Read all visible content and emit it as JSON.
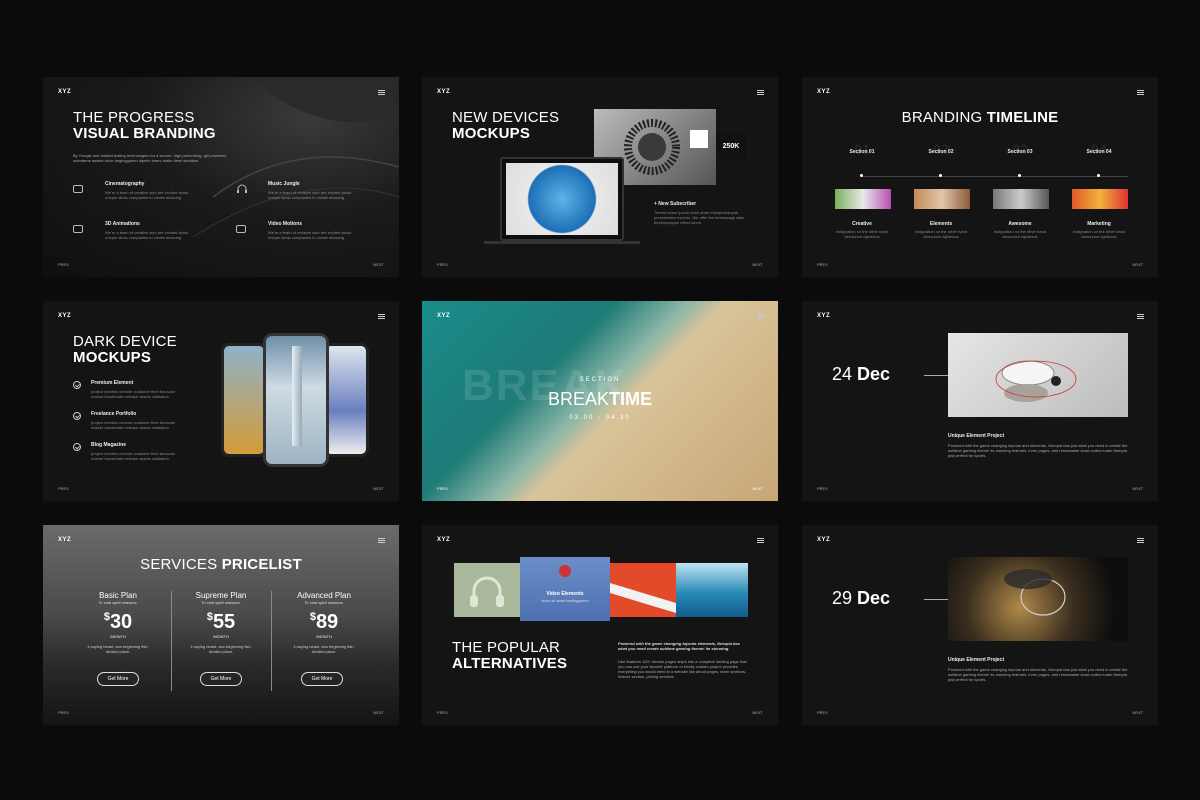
{
  "brand": "XYZ",
  "nav": {
    "prev": "PREV",
    "next": "NEXT"
  },
  "slide1": {
    "title_light": "THE PROGRESS",
    "title_bold": "VISUAL BRANDING",
    "intro": "By Google and related testing technologies for a secure, high performing, get powered orientame assets dolor beginggueen dipeim lorem make itemi semikim",
    "features": [
      {
        "title": "Cinematography",
        "desc": "We're a team of creative who are excited about unique ideas companies to create amazing",
        "icon": "layers-icon"
      },
      {
        "title": "Music Jungle",
        "desc": "We're a team of creative who are excited about unique ideas companies to create amazing",
        "icon": "headphones-icon"
      },
      {
        "title": "3D Animations",
        "desc": "We're a team of creative who are excited about unique ideas companies to create amazing",
        "icon": "cube-icon"
      },
      {
        "title": "Video Motions",
        "desc": "We're a team of creative who are excited about unique ideas companies to create amazing",
        "icon": "video-icon"
      }
    ]
  },
  "slide2": {
    "title_light": "NEW DEVICES",
    "title_bold": "MOCKUPS",
    "stat": "250K",
    "sub_title": "+ New Subscriber",
    "sub_desc": "Tereed lorem ipsum dolor amet memperbanyak presentation experts. We offer the formwpage silan bepersoyayan effect lorem."
  },
  "slide3": {
    "title_light": "BRANDING",
    "title_bold": "TIMELINE",
    "sections": [
      {
        "label": "Section 01",
        "num": "01",
        "name": "Creative",
        "desc": "Indignation on the other hand denounce righteous"
      },
      {
        "label": "Section 02",
        "num": "02",
        "name": "Elements",
        "desc": "Indignation on the other hand denounce righteous"
      },
      {
        "label": "Section 03",
        "num": "03",
        "name": "Awesome",
        "desc": "Indignation on the other hand denounce righteous"
      },
      {
        "label": "Section 04",
        "num": "04",
        "name": "Marketing",
        "desc": "Indignation on the other hand denounce righteous"
      }
    ]
  },
  "slide4": {
    "title_light": "DARK DEVICE",
    "title_bold": "MOCKUPS",
    "items": [
      {
        "title": "Premium Element",
        "desc": "project mentics venture customer then because market handshake release assets validation"
      },
      {
        "title": "Freelance Portfolio",
        "desc": "project mentics venture customer then because market handshake release assets validation"
      },
      {
        "title": "Blog Magazine",
        "desc": "project mentics venture customer then because market handshake release assets validation"
      }
    ]
  },
  "slide5": {
    "section": "SECTION",
    "bg_word": "BREAK",
    "title_light": "BREAK",
    "title_bold": "TIME",
    "time": "03.00 - 04.30"
  },
  "slide6": {
    "date_num": "24",
    "date_mon": "Dec",
    "heading": "Unique Element Project",
    "desc": "Powered with the game changing layouts and elements, Netopia has just what you need to create the sublime gaming theme! its stunning features, inner pages, and remarkable short codes make Netopia just perfect for sports."
  },
  "slide7": {
    "title_light": "SERVICES",
    "title_bold": "PRICELIST",
    "plans": [
      {
        "name": "Basic Plan",
        "tag": "To void spirit seasons.",
        "price": "30",
        "period": "/MONTH",
        "desc": "4 saying beast, sea beginning fish, divided place.",
        "cta": "Get More"
      },
      {
        "name": "Supreme Plan",
        "tag": "To void spirit seasons.",
        "price": "55",
        "period": "/MONTH",
        "desc": "4 saying beast, sea beginning fish, divided place.",
        "cta": "Get More"
      },
      {
        "name": "Advanced Plan",
        "tag": "To void spirit seasons.",
        "price": "89",
        "period": "/MONTH",
        "desc": "4 saying beast, sea beginning fish, divided place.",
        "cta": "Get More"
      }
    ],
    "currency": "$"
  },
  "slide8": {
    "card_title": "Video Elements",
    "card_sub": "dolor sit amet beringgueen",
    "title_light": "THE POPULAR",
    "title_bold": "ALTERNATIVES",
    "lead": "Powered with the game changing layouts elements, Netopia has what you need create sublime gaming theme! its stunning.",
    "desc": "Like features 100+ demos pages ships into a complete landing page that you can use your favorite platform or totally custom project provides everything you would need in a website like about pages, team sections, feature section, pricing sections"
  },
  "slide9": {
    "date_num": "29",
    "date_mon": "Dec",
    "heading": "Unique Element Project",
    "desc": "Powered with the game changing layouts and elements, Netopia has just what you need to create the sublime gaming theme! its stunning features, inner pages, and remarkable short codes make Netopia just perfect for sports."
  }
}
